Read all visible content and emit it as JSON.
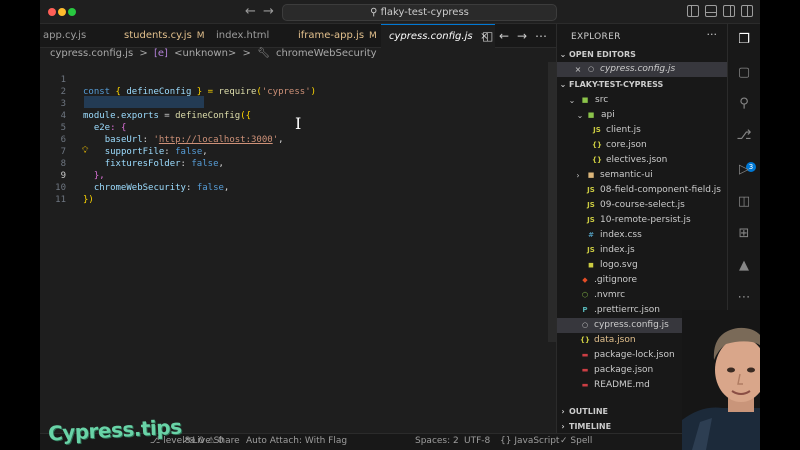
{
  "title_bar": {
    "search": "flaky-test-cypress"
  },
  "tabs": [
    {
      "label": "app.cy.js",
      "badge": ""
    },
    {
      "label": "students.cy.js",
      "badge": "M"
    },
    {
      "label": "index.html",
      "badge": ""
    },
    {
      "label": "iframe-app.js",
      "badge": "M"
    },
    {
      "label": "cypress.config.js",
      "badge": ""
    }
  ],
  "breadcrumb": {
    "file": "cypress.config.js",
    "sep1": ">",
    "sym1_icon": "[e]",
    "sym1": "<unknown>",
    "sep2": ">",
    "sym2": "chromeWebSecurity"
  },
  "code": {
    "line_numbers": [
      "1",
      "2",
      "3",
      "4",
      "5",
      "6",
      "7",
      "8",
      "9",
      "10",
      "11"
    ],
    "l1": {
      "kw": "const",
      "open": " { ",
      "var": "defineConfig",
      "close": " } = ",
      "fn": "require",
      "p1": "(",
      "str": "'cypress'",
      "p2": ")"
    },
    "l3": {
      "var": "module",
      "dot": ".",
      "var2": "exports",
      "eq": " = ",
      "fn": "defineConfig",
      "p": "({"
    },
    "l4": {
      "key": "e2e",
      "rest": ": {"
    },
    "l5": {
      "key": "baseUrl",
      "colon": ": ",
      "q1": "'",
      "url": "http://localhost:3000",
      "q2": "'",
      "comma": ","
    },
    "l6": {
      "key": "supportFile",
      "colon": ": ",
      "val": "false",
      "comma": ","
    },
    "l7": {
      "key": "fixturesFolder",
      "colon": ": ",
      "val": "false",
      "comma": ","
    },
    "l8": {
      "text": "},"
    },
    "l9": {
      "key": "chromeWebSecurity",
      "colon": ": ",
      "val": "false",
      "comma": ","
    },
    "l10": {
      "text": "})"
    }
  },
  "explorer": {
    "title": "EXPLORER",
    "more": "···",
    "open_editors_header": "OPEN EDITORS",
    "open_editor_file": "cypress.config.js",
    "project_header": "FLAKY-TEST-CYPRESS",
    "tree": [
      {
        "name": "src",
        "kind": "folder-open"
      },
      {
        "name": "api",
        "kind": "folder-open"
      },
      {
        "name": "client.js",
        "kind": "js"
      },
      {
        "name": "core.json",
        "kind": "json"
      },
      {
        "name": "electives.json",
        "kind": "json"
      },
      {
        "name": "semantic-ui",
        "kind": "folder"
      },
      {
        "name": "08-field-component-field.js",
        "kind": "js"
      },
      {
        "name": "09-course-select.js",
        "kind": "js"
      },
      {
        "name": "10-remote-persist.js",
        "kind": "js"
      },
      {
        "name": "index.css",
        "kind": "css"
      },
      {
        "name": "index.js",
        "kind": "js"
      },
      {
        "name": "logo.svg",
        "kind": "svg"
      },
      {
        "name": ".gitignore",
        "kind": "git"
      },
      {
        "name": ".nvmrc",
        "kind": "node"
      },
      {
        "name": ".prettierrc.json",
        "kind": "prettier"
      },
      {
        "name": "cypress.config.js",
        "kind": "cypress"
      },
      {
        "name": "data.json",
        "kind": "json",
        "badge": "M"
      },
      {
        "name": "package-lock.json",
        "kind": "lock"
      },
      {
        "name": "package.json",
        "kind": "lock"
      },
      {
        "name": "README.md",
        "kind": "md"
      }
    ],
    "outline_header": "OUTLINE",
    "timeline_header": "TIMELINE"
  },
  "status_bar": {
    "level": "level8",
    "errors": "0",
    "warnings": "0",
    "live_share": "Live Share",
    "auto_attach": "Auto Attach: With Flag",
    "spaces": "Spaces: 2",
    "encoding": "UTF-8",
    "language": "JavaScript",
    "spell": "Spell"
  },
  "activity_bar": {
    "source_control_badge": "3"
  },
  "watermark": "Cypress.tips",
  "colors": {
    "accent": "#0078d4",
    "modified": "#e2c08d",
    "editor_bg": "#1e1e1e",
    "sidebar_bg": "#181818"
  }
}
